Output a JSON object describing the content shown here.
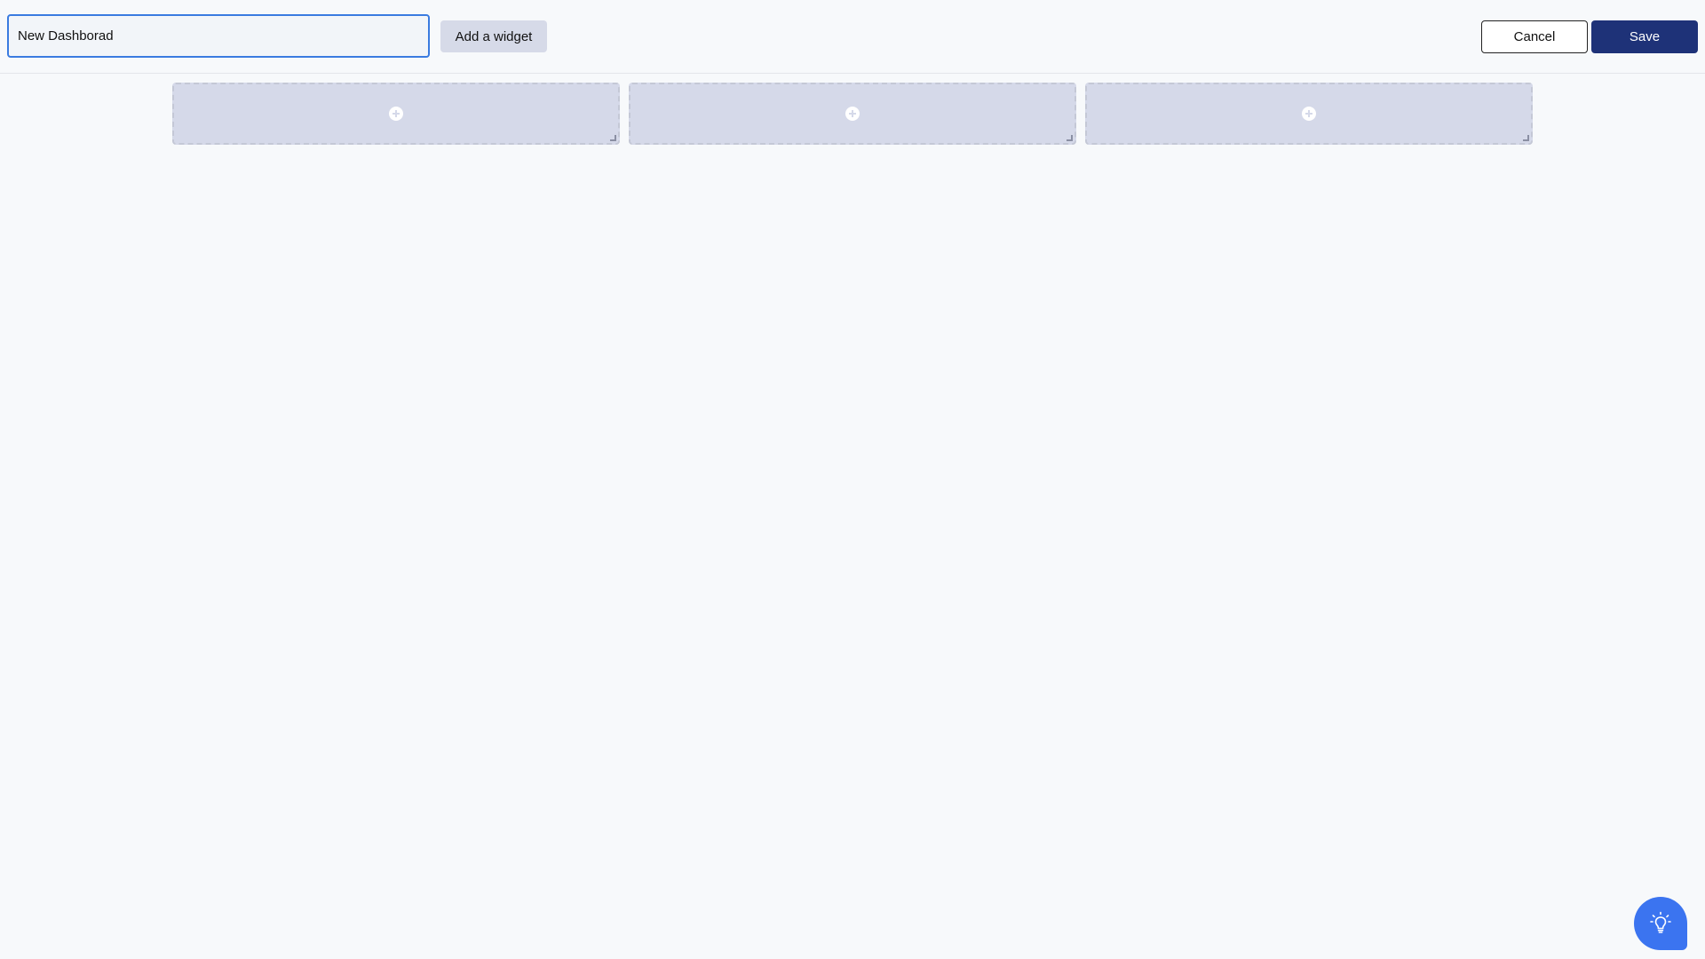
{
  "header": {
    "dashboard_name_value": "New Dashborad",
    "add_widget_label": "Add a widget",
    "cancel_label": "Cancel",
    "save_label": "Save"
  },
  "widget_slots": [
    {
      "icon": "plus-circle-icon"
    },
    {
      "icon": "plus-circle-icon"
    },
    {
      "icon": "plus-circle-icon"
    }
  ],
  "help": {
    "icon": "lightbulb-icon"
  },
  "colors": {
    "accent": "#3a7be0",
    "primary_button": "#1e3278",
    "slot_background": "#d5d9e9",
    "help_bubble": "#3b74f0",
    "page_background": "#f7f9fb"
  }
}
